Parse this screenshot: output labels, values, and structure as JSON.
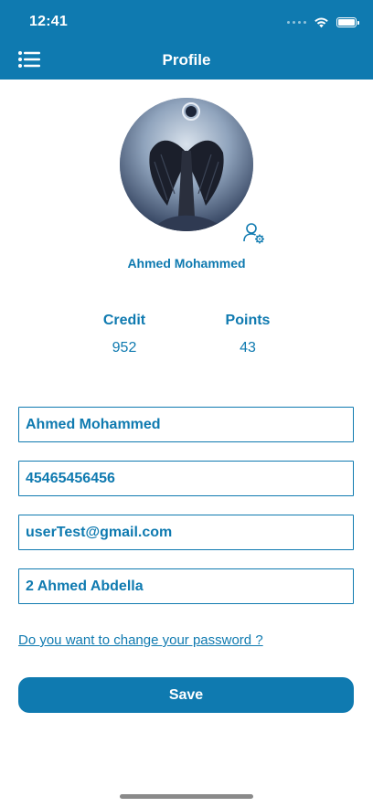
{
  "status_bar": {
    "time": "12:41"
  },
  "header": {
    "title": "Profile"
  },
  "profile": {
    "name": "Ahmed Mohammed"
  },
  "stats": {
    "credit": {
      "label": "Credit",
      "value": "952"
    },
    "points": {
      "label": "Points",
      "value": "43"
    }
  },
  "form": {
    "full_name": "Ahmed Mohammed",
    "phone": "45465456456",
    "email": "userTest@gmail.com",
    "address": "2 Ahmed Abdella"
  },
  "links": {
    "change_password": "Do you want to change your password ?"
  },
  "actions": {
    "save_label": "Save"
  },
  "icons": [
    "menu-icon",
    "wifi-icon",
    "battery-icon",
    "user-settings-icon"
  ],
  "colors": {
    "primary": "#0f7ab0",
    "background": "#ffffff"
  }
}
